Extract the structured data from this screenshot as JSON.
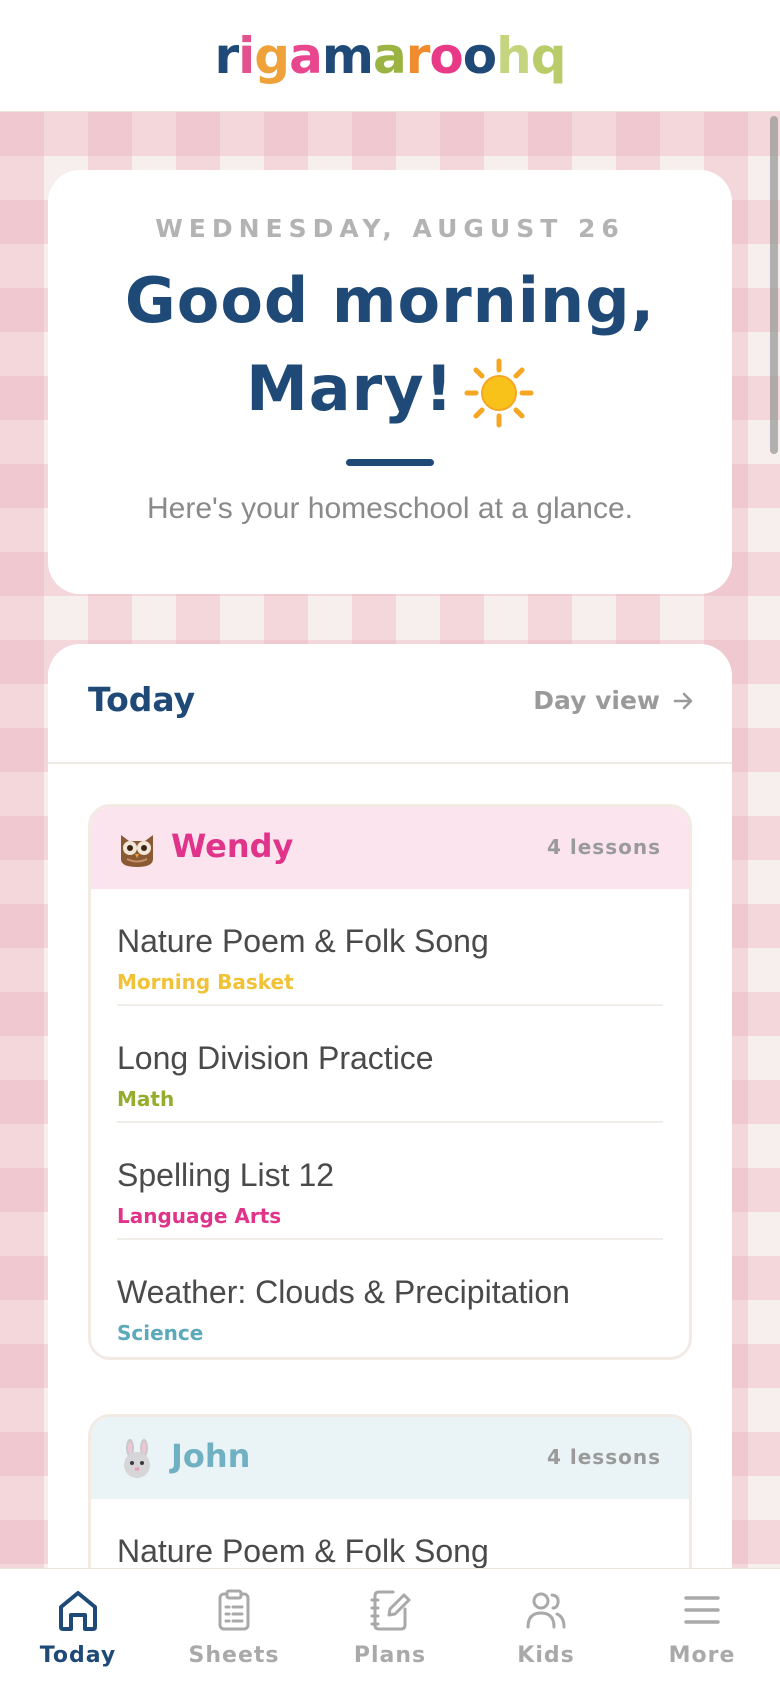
{
  "logo": {
    "text": "rigamaroohq",
    "letters": [
      {
        "ch": "r",
        "color": "#1f4a78"
      },
      {
        "ch": "i",
        "color": "#e1528f"
      },
      {
        "ch": "g",
        "color": "#f0a23a"
      },
      {
        "ch": "a",
        "color": "#e8478f"
      },
      {
        "ch": "m",
        "color": "#1f4a78"
      },
      {
        "ch": "a",
        "color": "#9ab342"
      },
      {
        "ch": "r",
        "color": "#f08c2d"
      },
      {
        "ch": "o",
        "color": "#e83a86"
      },
      {
        "ch": "o",
        "color": "#1f4a78"
      },
      {
        "ch": "h",
        "color": "#c5d47e"
      },
      {
        "ch": "q",
        "color": "#b9cc6a"
      }
    ]
  },
  "greeting": {
    "date": "WEDNESDAY, AUGUST 26",
    "line1": "Good morning,",
    "line2": "Mary!",
    "subtitle": "Here's your homeschool at a glance."
  },
  "today": {
    "title": "Today",
    "day_view": "Day view",
    "kids": [
      {
        "name": "Wendy",
        "avatar_icon": "owl-icon",
        "name_color": "#e0338a",
        "header_bg": "#fce4ef",
        "count": "4 lessons",
        "lessons": [
          {
            "title": "Nature Poem & Folk Song",
            "subject": "Morning Basket",
            "subject_color": "#f2c236"
          },
          {
            "title": "Long Division Practice",
            "subject": "Math",
            "subject_color": "#94ad2e"
          },
          {
            "title": "Spelling List 12",
            "subject": "Language Arts",
            "subject_color": "#e0338a"
          },
          {
            "title": "Weather: Clouds & Precipitation",
            "subject": "Science",
            "subject_color": "#5ba9bb"
          }
        ]
      },
      {
        "name": "John",
        "avatar_icon": "bunny-icon",
        "name_color": "#6fb0c2",
        "header_bg": "#eaf3f5",
        "count": "4 lessons",
        "lessons": [
          {
            "title": "Nature Poem & Folk Song",
            "subject": "",
            "subject_color": "#f2c236"
          }
        ]
      }
    ]
  },
  "nav": {
    "items": [
      {
        "label": "Today",
        "icon": "home-icon",
        "active": true
      },
      {
        "label": "Sheets",
        "icon": "clipboard-icon",
        "active": false
      },
      {
        "label": "Plans",
        "icon": "notebook-icon",
        "active": false
      },
      {
        "label": "Kids",
        "icon": "people-icon",
        "active": false
      },
      {
        "label": "More",
        "icon": "menu-icon",
        "active": false
      }
    ]
  }
}
